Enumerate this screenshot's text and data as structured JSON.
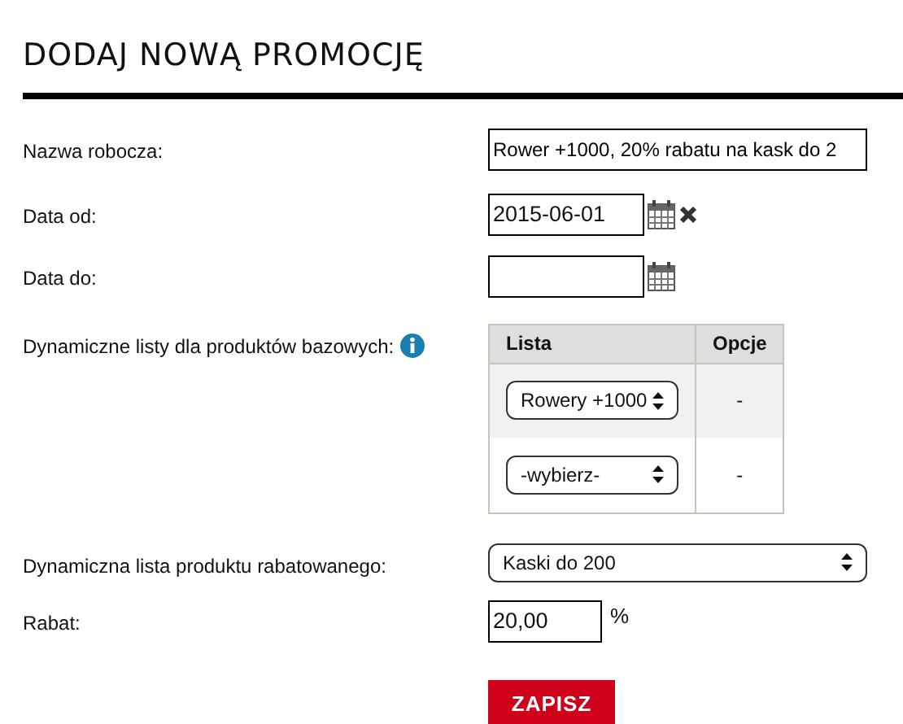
{
  "title": "DODAJ NOWĄ PROMOCJĘ",
  "fields": [
    {
      "kind": "text",
      "label": "Nazwa robocza:",
      "value": "Rower +1000, 20% rabatu na kask do 2"
    },
    {
      "kind": "date",
      "label": "Data od:",
      "value": "2015-06-01",
      "clearable": true
    },
    {
      "kind": "date",
      "label": "Data do:",
      "clearable": false
    },
    {
      "kind": "table",
      "label": "Dynamiczne listy dla produktów bazowych:",
      "columns": [
        "Lista",
        "Opcje"
      ],
      "rows": [
        {
          "select": "Rowery +1000",
          "options": "-"
        },
        {
          "select": "-wybierz-",
          "options": "-"
        }
      ]
    },
    {
      "kind": "select",
      "label": "Dynamiczna lista produktu rabatowanego:",
      "value": "Kaski do 200"
    },
    {
      "kind": "number",
      "label": "Rabat:",
      "value": "20,00",
      "unit": "%"
    }
  ],
  "submit": "ZAPISZ"
}
